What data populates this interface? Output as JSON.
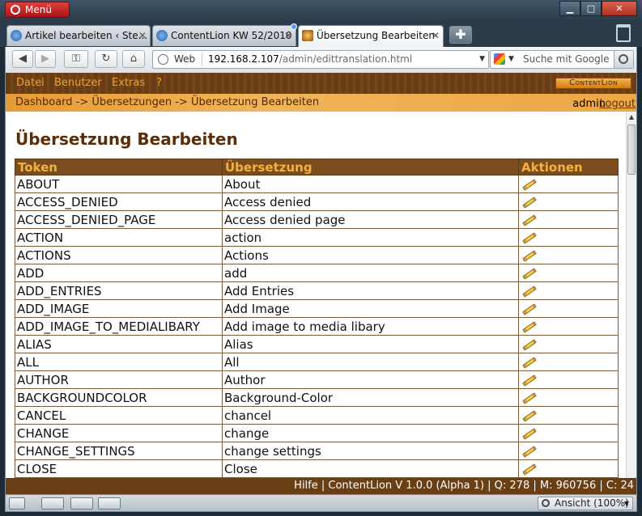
{
  "browser": {
    "menu_label": "Menü",
    "tabs": [
      {
        "title": "Artikel bearbeiten ‹ Ste..."
      },
      {
        "title": "ContentLion KW 52/2010"
      },
      {
        "title": "Übersetzung Bearbeiten"
      }
    ],
    "address": {
      "web_label": "Web",
      "host": "192.168.2.107",
      "path": "/admin/edittranslation.html"
    },
    "search_placeholder": "Suche mit Google",
    "zoom_label": "Ansicht (100%)"
  },
  "site": {
    "menu": [
      "Datei",
      "Benutzer",
      "Extras",
      "?"
    ],
    "brand": "ContentLion",
    "breadcrumb": "Dashboard -> Übersetzungen -> Übersetzung Bearbeiten",
    "username": "admin",
    "separator": "|",
    "logout_label": "Logout",
    "heading": "Übersetzung Bearbeiten",
    "table": {
      "headers": [
        "Token",
        "Übersetzung",
        "Aktionen"
      ],
      "rows": [
        [
          "ABOUT",
          "About"
        ],
        [
          "ACCESS_DENIED",
          "Access denied"
        ],
        [
          "ACCESS_DENIED_PAGE",
          "Access denied page"
        ],
        [
          "ACTION",
          "action"
        ],
        [
          "ACTIONS",
          "Actions"
        ],
        [
          "ADD",
          "add"
        ],
        [
          "ADD_ENTRIES",
          "Add Entries"
        ],
        [
          "ADD_IMAGE",
          "Add Image"
        ],
        [
          "ADD_IMAGE_TO_MEDIALIBARY",
          "Add image to media libary"
        ],
        [
          "ALIAS",
          "Alias"
        ],
        [
          "ALL",
          "All"
        ],
        [
          "AUTHOR",
          "Author"
        ],
        [
          "BACKGROUNDCOLOR",
          "Background-Color"
        ],
        [
          "CANCEL",
          "chancel"
        ],
        [
          "CHANGE",
          "change"
        ],
        [
          "CHANGE_SETTINGS",
          "change settings"
        ],
        [
          "CLOSE",
          "Close"
        ]
      ]
    },
    "footer": "Hilfe | ContentLion V 1.0.0 (Alpha 1) | Q: 278 | M: 960756 | C: 24"
  }
}
